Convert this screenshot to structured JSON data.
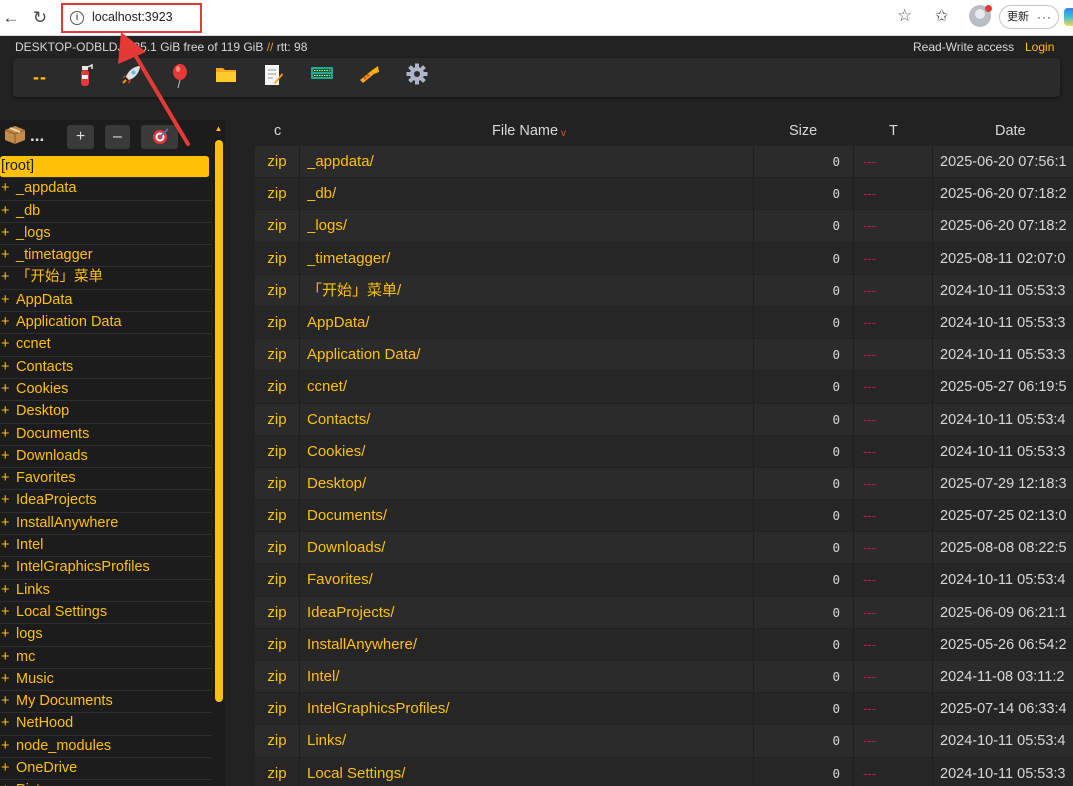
{
  "browser": {
    "url": "localhost:3923",
    "update_label": "更新",
    "more_label": "···",
    "icons": {
      "back": "back-arrow-icon",
      "reload": "reload-icon",
      "info": "info-icon",
      "star": "star-icon",
      "favorites": "favorites-icon",
      "profile": "profile-avatar"
    }
  },
  "header": {
    "host": "DESKTOP-ODBLDJ7",
    "disk": "35.1 GiB free of 119 GiB",
    "rtt": "rtt: 98",
    "access": "Read-Write access",
    "login": "Login"
  },
  "toolbar": {
    "dashes": "--",
    "icons": [
      "fire-extinguisher-icon",
      "rocket-icon",
      "balloon-icon",
      "folder-icon",
      "notepad-icon",
      "keyboard-icon",
      "trumpet-icon",
      "gear-icon"
    ]
  },
  "tree": {
    "header": {
      "dots": "...",
      "plus": "+",
      "minus": "–"
    },
    "root": "[root]",
    "items": [
      "_appdata",
      "_db",
      "_logs",
      "_timetagger",
      "「开始」菜单",
      "AppData",
      "Application Data",
      "ccnet",
      "Contacts",
      "Cookies",
      "Desktop",
      "Documents",
      "Downloads",
      "Favorites",
      "IdeaProjects",
      "InstallAnywhere",
      "Intel",
      "IntelGraphicsProfiles",
      "Links",
      "Local Settings",
      "logs",
      "mc",
      "Music",
      "My Documents",
      "NetHood",
      "node_modules",
      "OneDrive",
      "Pictures"
    ]
  },
  "files": {
    "columns": {
      "c": "c",
      "name": "File Name",
      "sort_mark": "v",
      "size": "Size",
      "t": "T",
      "date": "Date"
    },
    "rows": [
      {
        "zip": "zip",
        "name": "_appdata/",
        "size": "0",
        "t": "---",
        "date": "2025-06-20 07:56:1"
      },
      {
        "zip": "zip",
        "name": "_db/",
        "size": "0",
        "t": "---",
        "date": "2025-06-20 07:18:2"
      },
      {
        "zip": "zip",
        "name": "_logs/",
        "size": "0",
        "t": "---",
        "date": "2025-06-20 07:18:2"
      },
      {
        "zip": "zip",
        "name": "_timetagger/",
        "size": "0",
        "t": "---",
        "date": "2025-08-11 02:07:0"
      },
      {
        "zip": "zip",
        "name": "「开始」菜单/",
        "size": "0",
        "t": "---",
        "date": "2024-10-11 05:53:3"
      },
      {
        "zip": "zip",
        "name": "AppData/",
        "size": "0",
        "t": "---",
        "date": "2024-10-11 05:53:3"
      },
      {
        "zip": "zip",
        "name": "Application Data/",
        "size": "0",
        "t": "---",
        "date": "2024-10-11 05:53:3"
      },
      {
        "zip": "zip",
        "name": "ccnet/",
        "size": "0",
        "t": "---",
        "date": "2025-05-27 06:19:5"
      },
      {
        "zip": "zip",
        "name": "Contacts/",
        "size": "0",
        "t": "---",
        "date": "2024-10-11 05:53:4"
      },
      {
        "zip": "zip",
        "name": "Cookies/",
        "size": "0",
        "t": "---",
        "date": "2024-10-11 05:53:3"
      },
      {
        "zip": "zip",
        "name": "Desktop/",
        "size": "0",
        "t": "---",
        "date": "2025-07-29 12:18:3"
      },
      {
        "zip": "zip",
        "name": "Documents/",
        "size": "0",
        "t": "---",
        "date": "2025-07-25 02:13:0"
      },
      {
        "zip": "zip",
        "name": "Downloads/",
        "size": "0",
        "t": "---",
        "date": "2025-08-08 08:22:5"
      },
      {
        "zip": "zip",
        "name": "Favorites/",
        "size": "0",
        "t": "---",
        "date": "2024-10-11 05:53:4"
      },
      {
        "zip": "zip",
        "name": "IdeaProjects/",
        "size": "0",
        "t": "---",
        "date": "2025-06-09 06:21:1"
      },
      {
        "zip": "zip",
        "name": "InstallAnywhere/",
        "size": "0",
        "t": "---",
        "date": "2025-05-26 06:54:2"
      },
      {
        "zip": "zip",
        "name": "Intel/",
        "size": "0",
        "t": "---",
        "date": "2024-11-08 03:11:2"
      },
      {
        "zip": "zip",
        "name": "IntelGraphicsProfiles/",
        "size": "0",
        "t": "---",
        "date": "2025-07-14 06:33:4"
      },
      {
        "zip": "zip",
        "name": "Links/",
        "size": "0",
        "t": "---",
        "date": "2024-10-11 05:53:4"
      },
      {
        "zip": "zip",
        "name": "Local Settings/",
        "size": "0",
        "t": "---",
        "date": "2024-10-11 05:53:3"
      }
    ]
  },
  "colors": {
    "accent": "#ffc107",
    "background": "#222222",
    "t_column": "#c2185b",
    "annotation": "#e53935"
  }
}
